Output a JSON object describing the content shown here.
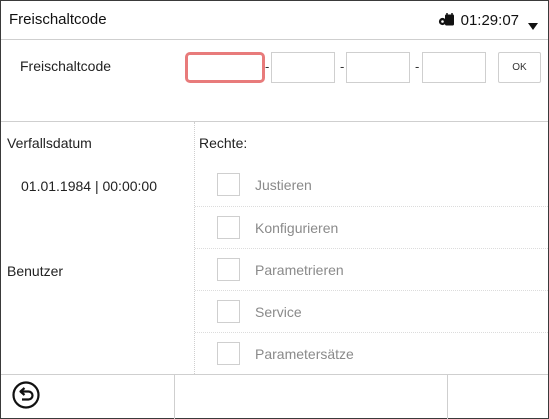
{
  "header": {
    "title": "Freischaltcode",
    "time": "01:29:07",
    "lock_icon": "lock-key-icon",
    "menu_icon": "dropdown-triangle-icon"
  },
  "code_entry": {
    "label": "Freischaltcode",
    "fields": [
      "",
      "",
      "",
      ""
    ],
    "separator": "-",
    "ok_label": "OK"
  },
  "details": {
    "expiry_label": "Verfallsdatum",
    "expiry_value": "01.01.1984 | 00:00:00",
    "user_label": "Benutzer",
    "rights_label": "Rechte:",
    "rights": [
      {
        "label": "Justieren",
        "checked": false
      },
      {
        "label": "Konfigurieren",
        "checked": false
      },
      {
        "label": "Parametrieren",
        "checked": false
      },
      {
        "label": "Service",
        "checked": false
      },
      {
        "label": "Parametersätze",
        "checked": false
      }
    ]
  },
  "footer": {
    "back_icon": "back-arrow-icon"
  },
  "colors": {
    "active_field_border": "#e87b7b",
    "divider": "#cfcfcf",
    "disabled_text": "#8a8a8a"
  }
}
